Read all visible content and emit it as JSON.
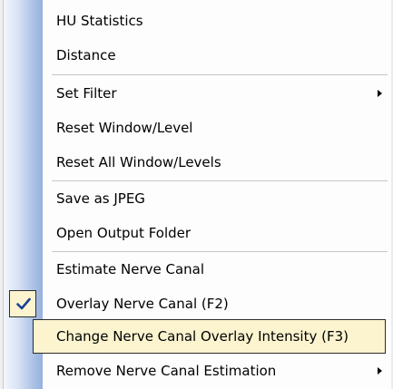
{
  "menu": {
    "items": [
      {
        "label": "HU Statistics"
      },
      {
        "label": "Distance"
      },
      {
        "label": "Set Filter",
        "has_submenu": true
      },
      {
        "label": "Reset Window/Level"
      },
      {
        "label": "Reset All Window/Levels"
      },
      {
        "label": "Save as JPEG"
      },
      {
        "label": "Open Output Folder"
      },
      {
        "label": "Estimate Nerve Canal"
      },
      {
        "label": "Overlay Nerve Canal (F2)",
        "checked": true
      },
      {
        "label": "Change Nerve Canal Overlay Intensity (F3)",
        "highlighted": true
      },
      {
        "label": "Remove Nerve Canal Estimation",
        "has_submenu": true
      }
    ],
    "icons": {
      "check": "checkmark-icon",
      "submenu": "submenu-arrow-icon"
    },
    "colors": {
      "highlight_background": "#fbf4cf",
      "highlight_border": "#2c2c2c",
      "gutter_gradient_start": "#f4f7fc",
      "gutter_gradient_end": "#96b1de",
      "separator": "#c5c5c5",
      "checkmark": "#1c3f94"
    }
  }
}
